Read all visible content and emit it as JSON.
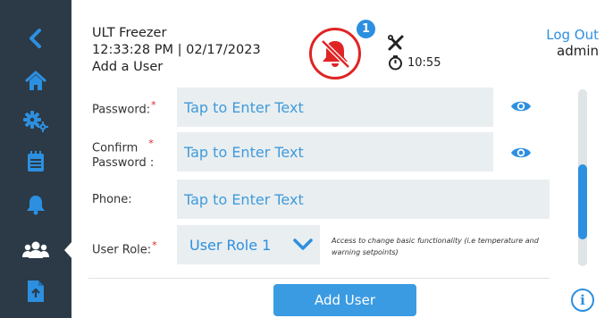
{
  "header": {
    "device_name": "ULT Freezer",
    "datetime": "12:33:28 PM | 02/17/2023",
    "page_title": "Add a User",
    "alarm_count": "1",
    "timer": "10:55",
    "logout_label": "Log Out",
    "username": "admin"
  },
  "sidebar": {
    "items": [
      {
        "icon": "back-icon"
      },
      {
        "icon": "home-icon"
      },
      {
        "icon": "settings-icon"
      },
      {
        "icon": "log-icon"
      },
      {
        "icon": "bell-icon"
      },
      {
        "icon": "users-icon",
        "active": true
      },
      {
        "icon": "export-icon"
      }
    ]
  },
  "form": {
    "password": {
      "label": "Password:",
      "placeholder": "Tap to Enter Text"
    },
    "confirm": {
      "label_line1": "Confirm",
      "label_line2": "Password :",
      "placeholder": "Tap to Enter Text"
    },
    "phone": {
      "label": "Phone:",
      "placeholder": "Tap to Enter Text"
    },
    "role": {
      "label": "User Role:",
      "value": "User Role 1",
      "description": "Access to change basic functionality (i.e temperature and warning setpoints)"
    },
    "required_mark": "*"
  },
  "actions": {
    "add_user_label": "Add User",
    "info_label": "i"
  },
  "colors": {
    "sidebar_bg": "#2b3a46",
    "accent": "#2d8fe0",
    "alarm_red": "#e02424",
    "input_bg": "#e9eef0"
  },
  "scroll": {
    "position_fraction": 0.55
  }
}
